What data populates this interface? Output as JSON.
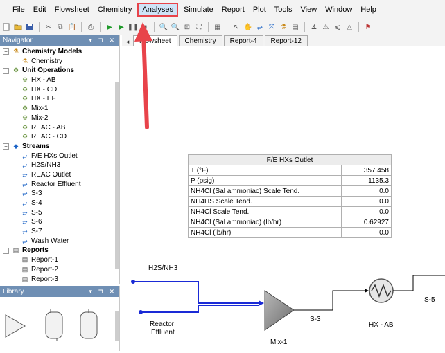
{
  "menu": {
    "items": [
      {
        "label": "File"
      },
      {
        "label": "Edit"
      },
      {
        "label": "Flowsheet"
      },
      {
        "label": "Chemistry"
      },
      {
        "label": "Analyses"
      },
      {
        "label": "Simulate"
      },
      {
        "label": "Report"
      },
      {
        "label": "Plot"
      },
      {
        "label": "Tools"
      },
      {
        "label": "View"
      },
      {
        "label": "Window"
      },
      {
        "label": "Help"
      }
    ]
  },
  "navigator": {
    "title": "Navigator",
    "tree": {
      "chem_models": "Chemistry Models",
      "chemistry": "Chemistry",
      "unit_ops": "Unit Operations",
      "units": [
        "HX - AB",
        "HX - CD",
        "HX - EF",
        "Mix-1",
        "Mix-2",
        "REAC - AB",
        "REAC - CD"
      ],
      "streams_label": "Streams",
      "streams": [
        "F/E HXs Outlet",
        "H2S/NH3",
        "REAC Outlet",
        "Reactor Effluent",
        "S-3",
        "S-4",
        "S-5",
        "S-6",
        "S-7",
        "Wash Water"
      ],
      "reports_label": "Reports",
      "reports": [
        "Report-1",
        "Report-2",
        "Report-3"
      ]
    }
  },
  "library": {
    "title": "Library"
  },
  "tabs": [
    {
      "label": "Flowsheet"
    },
    {
      "label": "Chemistry"
    },
    {
      "label": "Report-4"
    },
    {
      "label": "Report-12"
    }
  ],
  "table": {
    "title": "F/E HXs Outlet",
    "rows": [
      {
        "label": "T (°F)",
        "value": "357.458"
      },
      {
        "label": "P (psig)",
        "value": "1135.3"
      },
      {
        "label": "NH4Cl (Sal ammoniac) Scale Tend.",
        "value": "0.0"
      },
      {
        "label": "NH4HS Scale Tend.",
        "value": "0.0"
      },
      {
        "label": "NH4Cl Scale Tend.",
        "value": "0.0"
      },
      {
        "label": "NH4Cl (Sal ammoniac) (lb/hr)",
        "value": "0.62927"
      },
      {
        "label": "NH4Cl (lb/hr)",
        "value": "0.0"
      }
    ]
  },
  "flowsheet": {
    "h2s_label": "H2S/NH3",
    "reactor_label_1": "Reactor",
    "reactor_label_2": "Effluent",
    "mix_label": "Mix-1",
    "s3_label": "S-3",
    "hx_label": "HX - AB",
    "s5_label": "S-5"
  },
  "colors": {
    "menu_highlight_border": "#e8434a",
    "menu_highlight_fill": "#cfe3f7",
    "panel_header": "#6f8fb4",
    "stream_blue": "#1a2ad6",
    "arrow_red": "#e8434a"
  }
}
